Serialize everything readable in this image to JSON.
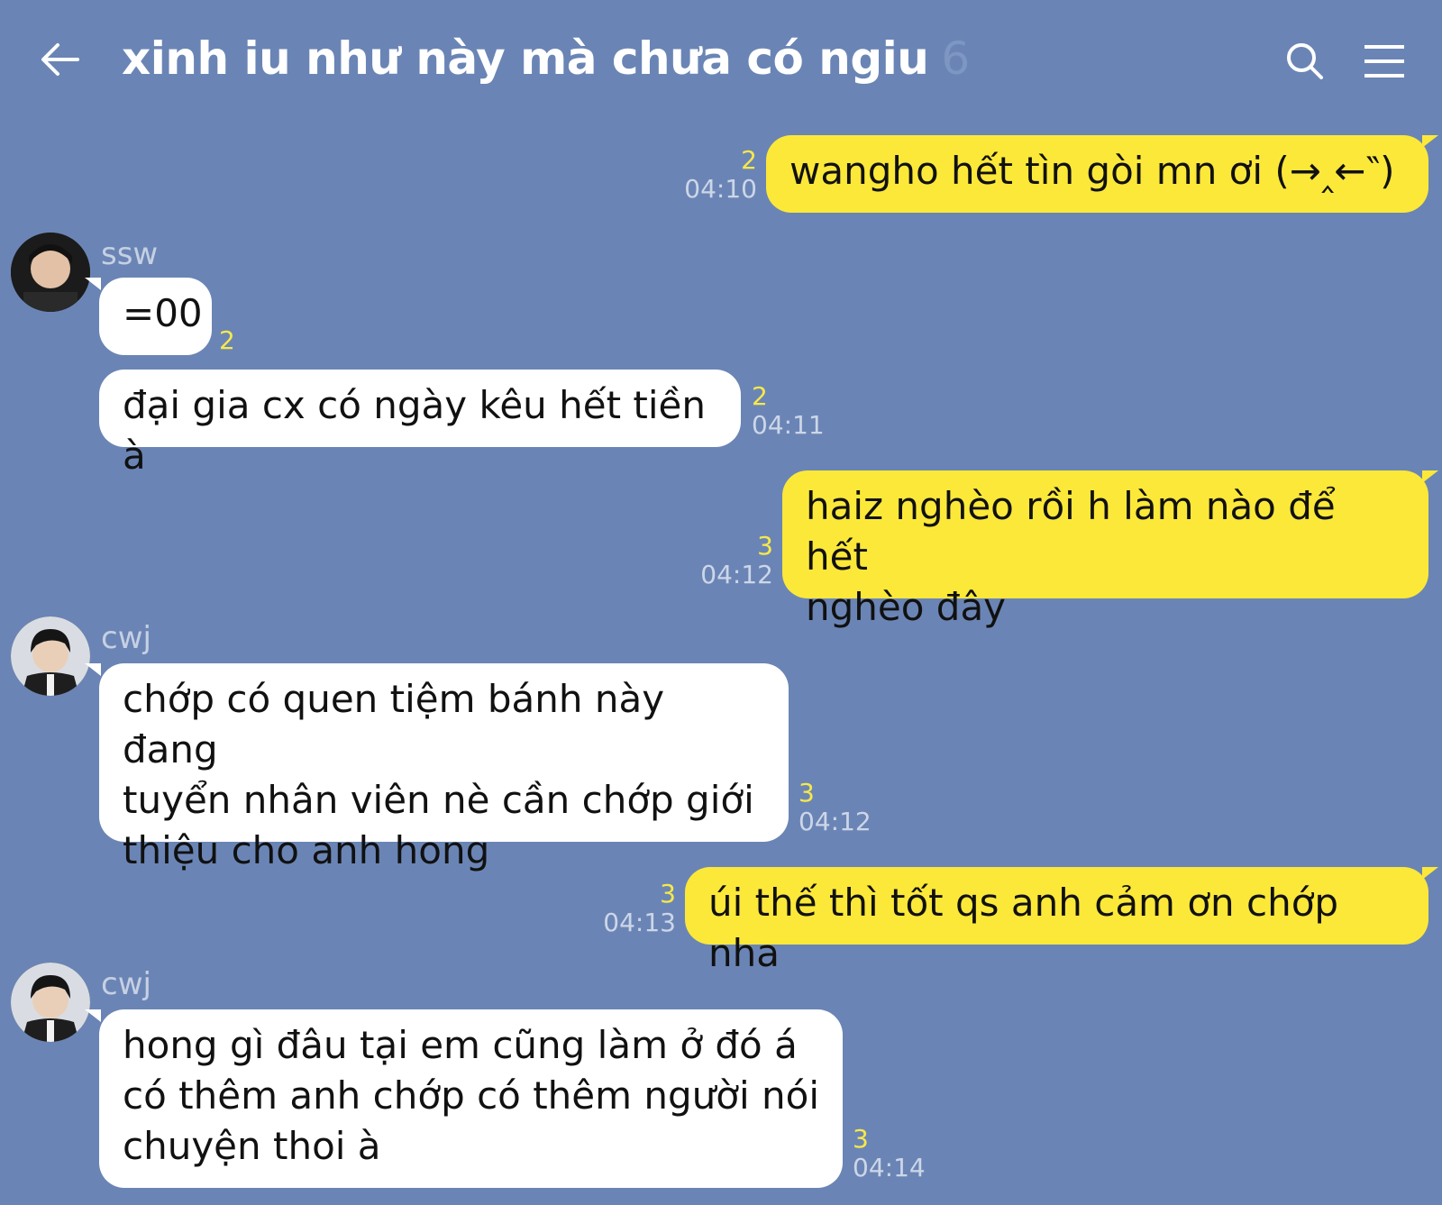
{
  "header": {
    "title": "xinh iu như này mà chưa có ngiu",
    "member_count": "6"
  },
  "messages": [
    {
      "from": "me",
      "text": "wangho hết tìn gòi mn ơi (→‸←‶)",
      "read": "2",
      "time": "04:10"
    },
    {
      "from": "ssw",
      "sender": "ssw",
      "text": "=00",
      "read": "2",
      "time": ""
    },
    {
      "from": "ssw",
      "text": "đại gia cx có ngày kêu hết tiền à",
      "read": "2",
      "time": "04:11"
    },
    {
      "from": "me",
      "text_lines": [
        "haiz nghèo rồi h làm nào để hết",
        "nghèo đây"
      ],
      "read": "3",
      "time": "04:12"
    },
    {
      "from": "cwj",
      "sender": "cwj",
      "text_lines": [
        "chớp có quen tiệm bánh này đang",
        "tuyển nhân viên nè cần chớp giới",
        "thiệu cho anh hong"
      ],
      "read": "3",
      "time": "04:12"
    },
    {
      "from": "me",
      "text": "úi thế thì tốt qs anh cảm ơn chớp nha",
      "read": "3",
      "time": "04:13"
    },
    {
      "from": "cwj",
      "sender": "cwj",
      "text_lines": [
        "hong gì đâu tại em cũng làm ở đó á",
        "có thêm anh chớp có thêm người nói",
        "chuyện thoi à"
      ],
      "read": "3",
      "time": "04:14"
    }
  ],
  "icons": {
    "back": "arrow-left-icon",
    "search": "search-icon",
    "menu": "hamburger-menu-icon",
    "avatar_ssw": "avatar",
    "avatar_cwj": "avatar"
  },
  "colors": {
    "background": "#6a85b5",
    "my_bubble": "#fce839",
    "their_bubble": "#ffffff",
    "read_count": "#f7e84a",
    "timestamp": "#cdd6e8"
  }
}
